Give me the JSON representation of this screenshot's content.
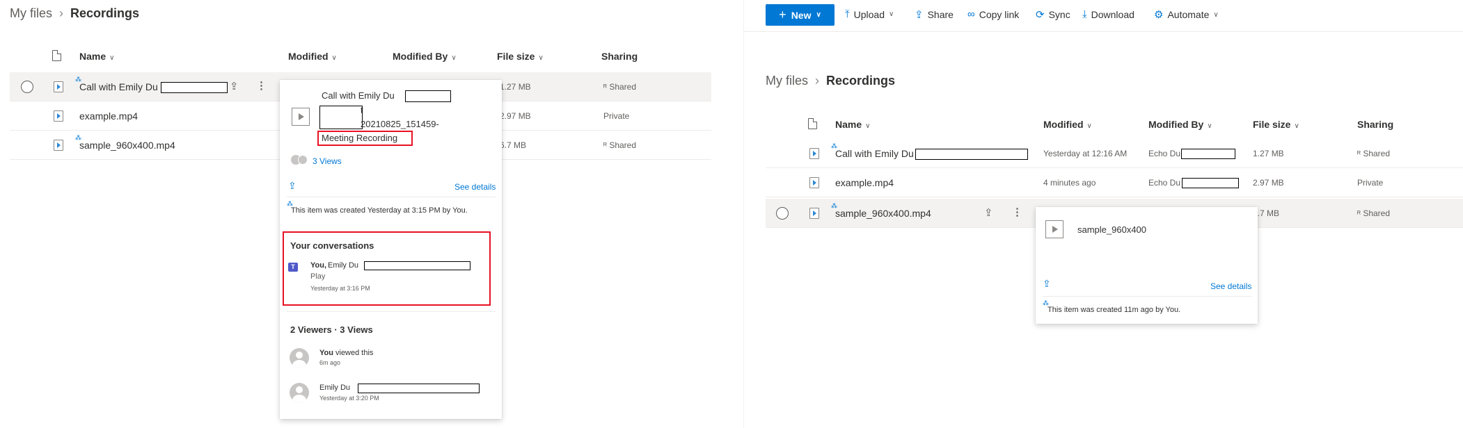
{
  "breadcrumb": {
    "root": "My files",
    "separator": "›",
    "current": "Recordings"
  },
  "toolbar": {
    "new": "New",
    "upload": "Upload",
    "share": "Share",
    "copy_link": "Copy link",
    "sync": "Sync",
    "download": "Download",
    "automate": "Automate"
  },
  "columns": {
    "name": "Name",
    "modified": "Modified",
    "modified_by": "Modified By",
    "file_size": "File size",
    "sharing": "Sharing"
  },
  "left_rows": [
    {
      "name": "Call with Emily Du",
      "size": "1.27 MB",
      "sharing": "Shared"
    },
    {
      "name": "example.mp4",
      "size": "2.97 MB",
      "sharing": "Private"
    },
    {
      "name": "sample_960x400.mp4",
      "size": "6.7 MB",
      "sharing": "Shared"
    }
  ],
  "right_rows": [
    {
      "name": "Call with Emily Du",
      "modified": "Yesterday at 12:16 AM",
      "modified_by": "Echo Du",
      "size": "1.27 MB",
      "sharing": "Shared"
    },
    {
      "name": "example.mp4",
      "modified": "4 minutes ago",
      "modified_by": "Echo Du",
      "size": "2.97 MB",
      "sharing": "Private"
    },
    {
      "name": "sample_960x400.mp4",
      "modified": "",
      "modified_by": "",
      "size": "6.7 MB",
      "sharing": "Shared"
    }
  ],
  "left_card": {
    "title_line1": "Call with Emily Du",
    "title_line2": "t",
    "title_line3": "20210825_151459-",
    "title_line4": "Meeting Recording",
    "views": "3 Views",
    "see_details": "See details",
    "created": "This item was created Yesterday at 3:15 PM by You.",
    "conversations_title": "Your conversations",
    "conv_you": "You,",
    "conv_who": "Emily Du",
    "conv_action": "Play",
    "conv_time": "Yesterday at 3:16 PM",
    "viewers_title": "2 Viewers · 3 Views",
    "viewer1_name": "You",
    "viewer1_action": "viewed this",
    "viewer1_time": "6m ago",
    "viewer2_name": "Emily Du",
    "viewer2_time": "Yesterday at 3:20 PM"
  },
  "right_card": {
    "title": "sample_960x400",
    "see_details": "See details",
    "created": "This item was created 11m ago by You."
  },
  "colors": {
    "accent": "#0078d4",
    "highlight": "#e81123",
    "teams": "#5059c9"
  }
}
